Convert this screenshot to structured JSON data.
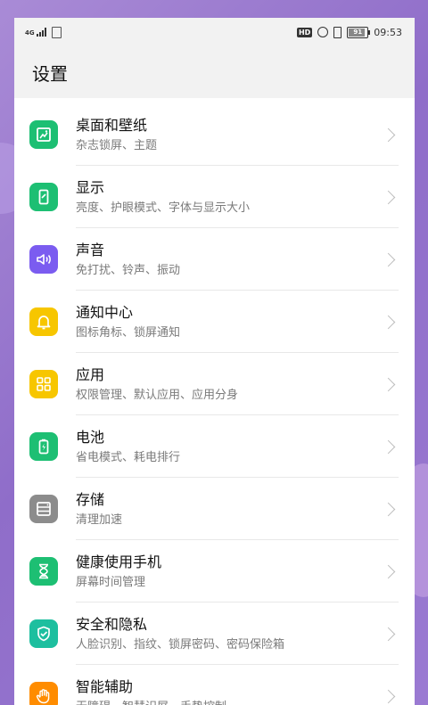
{
  "status_bar": {
    "network": "4G",
    "hd_label": "HD",
    "battery": "91",
    "time": "09:53"
  },
  "header": {
    "title": "设置"
  },
  "items": [
    {
      "title": "桌面和壁纸",
      "subtitle": "杂志锁屏、主题",
      "icon": "wallpaper-icon",
      "color": "#1dbf73"
    },
    {
      "title": "显示",
      "subtitle": "亮度、护眼模式、字体与显示大小",
      "icon": "display-icon",
      "color": "#1dbf73"
    },
    {
      "title": "声音",
      "subtitle": "免打扰、铃声、振动",
      "icon": "sound-icon",
      "color": "#7b5cf0"
    },
    {
      "title": "通知中心",
      "subtitle": "图标角标、锁屏通知",
      "icon": "bell-icon",
      "color": "#f7c600"
    },
    {
      "title": "应用",
      "subtitle": "权限管理、默认应用、应用分身",
      "icon": "apps-icon",
      "color": "#f7c600"
    },
    {
      "title": "电池",
      "subtitle": "省电模式、耗电排行",
      "icon": "battery-icon",
      "color": "#1dbf73"
    },
    {
      "title": "存储",
      "subtitle": "清理加速",
      "icon": "storage-icon",
      "color": "#8c8c8c"
    },
    {
      "title": "健康使用手机",
      "subtitle": "屏幕时间管理",
      "icon": "hourglass-icon",
      "color": "#1dbf73"
    },
    {
      "title": "安全和隐私",
      "subtitle": "人脸识别、指纹、锁屏密码、密码保险箱",
      "icon": "shield-icon",
      "color": "#1dbf9f"
    },
    {
      "title": "智能辅助",
      "subtitle": "无障碍、智慧识屏、手势控制",
      "icon": "hand-icon",
      "color": "#ff8c00"
    }
  ]
}
